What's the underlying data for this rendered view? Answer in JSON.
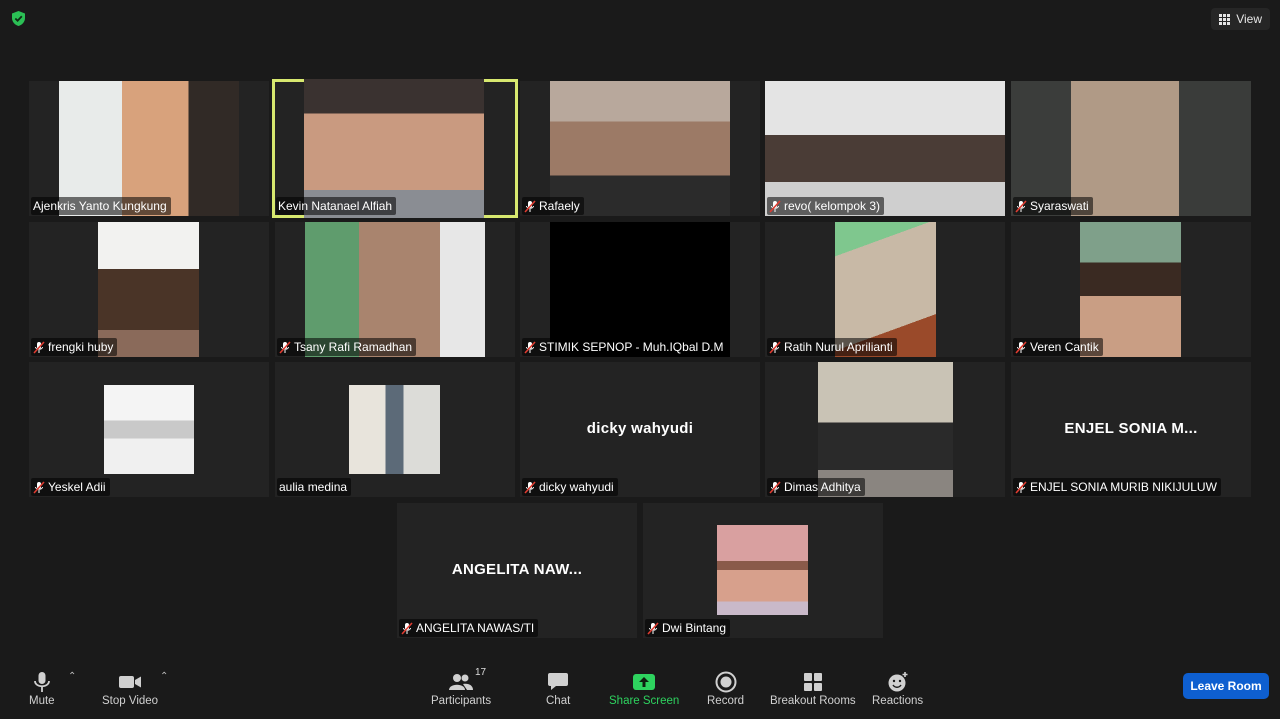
{
  "top": {
    "view_label": "View"
  },
  "participants": [
    {
      "name": "Ajenkris Yanto Kungkung",
      "muted": false
    },
    {
      "name": "Kevin Natanael Alfiah",
      "muted": false
    },
    {
      "name": "Rafaely",
      "muted": true
    },
    {
      "name": "revo( kelompok 3)",
      "muted": true
    },
    {
      "name": "Syaraswati",
      "muted": true
    },
    {
      "name": "frengki huby",
      "muted": true
    },
    {
      "name": "Tsany Rafi Ramadhan",
      "muted": true
    },
    {
      "name": "STIMIK SEPNOP - Muh.IQbal D.M",
      "muted": true
    },
    {
      "name": "Ratih Nurul Aprilianti",
      "muted": true
    },
    {
      "name": "Veren Cantik",
      "muted": true
    },
    {
      "name": "Yeskel Adii",
      "muted": true
    },
    {
      "name": "aulia medina",
      "muted": false
    },
    {
      "name": "dicky wahyudi",
      "muted": true,
      "display": "dicky wahyudi"
    },
    {
      "name": "Dimas Adhitya",
      "muted": true
    },
    {
      "name": "ENJEL SONIA MURIB NIKIJULUW",
      "muted": true,
      "display": "ENJEL SONIA M..."
    },
    {
      "name": "ANGELITA NAWAS/TI",
      "muted": true,
      "display": "ANGELITA  NAW..."
    },
    {
      "name": "Dwi Bintang",
      "muted": true
    }
  ],
  "toolbar": {
    "mute": "Mute",
    "stop_video": "Stop Video",
    "participants": "Participants",
    "participants_count": "17",
    "chat": "Chat",
    "share_screen": "Share Screen",
    "record": "Record",
    "breakout_rooms": "Breakout Rooms",
    "reactions": "Reactions",
    "leave": "Leave Room"
  },
  "colors": {
    "background": "#1a1a1a",
    "tile": "#232323",
    "active_speaker_border": "#d7e86f",
    "share_green": "#2ed35f",
    "leave_blue": "#0e5fd0",
    "mute_red": "#e03c31"
  }
}
